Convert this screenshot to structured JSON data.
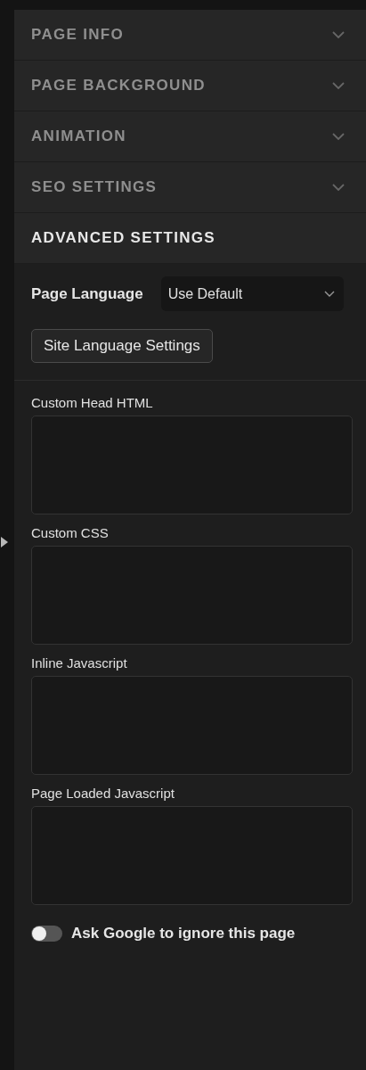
{
  "sections": [
    {
      "title": "PAGE INFO",
      "expanded": false
    },
    {
      "title": "PAGE BACKGROUND",
      "expanded": false
    },
    {
      "title": "ANIMATION",
      "expanded": false
    },
    {
      "title": "SEO SETTINGS",
      "expanded": false
    },
    {
      "title": "ADVANCED SETTINGS",
      "expanded": true
    }
  ],
  "page_language": {
    "label": "Page Language",
    "value": "Use Default"
  },
  "site_language_button": "Site Language Settings",
  "code_fields": [
    {
      "label": "Custom Head HTML"
    },
    {
      "label": "Custom CSS"
    },
    {
      "label": "Inline Javascript"
    },
    {
      "label": "Page Loaded Javascript"
    }
  ],
  "toggle": {
    "label": "Ask Google to ignore this page",
    "on": false
  }
}
